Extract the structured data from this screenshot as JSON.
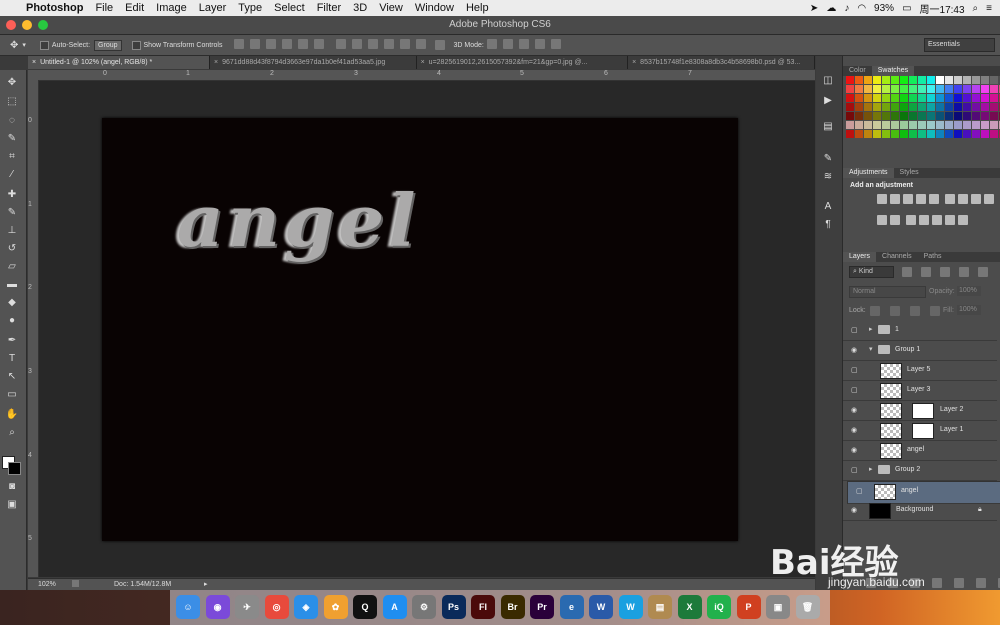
{
  "menubar": {
    "app": "Photoshop",
    "items": [
      "File",
      "Edit",
      "Image",
      "Layer",
      "Type",
      "Select",
      "Filter",
      "3D",
      "View",
      "Window",
      "Help"
    ],
    "battery": "93%",
    "clock": "周一17:43"
  },
  "window": {
    "title": "Adobe Photoshop CS6"
  },
  "options": {
    "auto_select_label": "Auto-Select:",
    "auto_select_value": "Group",
    "show_transform_label": "Show Transform Controls",
    "mode3d_label": "3D Mode:",
    "workspace": "Essentials"
  },
  "tabs": [
    {
      "label": "Untitled-1 @ 102% (angel, RGB/8) *"
    },
    {
      "label": "9671dd88d43f8794d3663e97da1b0ef41ad53aa5.jpg"
    },
    {
      "label": "u=2825619012,2615057392&fm=21&gp=0.jpg @..."
    },
    {
      "label": "8537b15748f1e8308a8db3c4b58698b0.psd @ 53..."
    }
  ],
  "ruler_h": [
    "0",
    "1",
    "2",
    "3",
    "4",
    "5",
    "6",
    "7"
  ],
  "ruler_v": [
    "0",
    "1",
    "2",
    "3",
    "4",
    "5"
  ],
  "canvas": {
    "text": "angel"
  },
  "status": {
    "zoom": "102%",
    "doc": "Doc: 1.54M/12.8M"
  },
  "panels": {
    "color_tabs": [
      "Color",
      "Swatches"
    ],
    "adjust_tabs": [
      "Adjustments",
      "Styles"
    ],
    "add_adjustment": "Add an adjustment",
    "layer_tabs": [
      "Layers",
      "Channels",
      "Paths"
    ],
    "kind": "Kind",
    "blend": "Normal",
    "opacity_label": "Opacity:",
    "opacity": "100%",
    "lock_label": "Lock:",
    "fill_label": "Fill:",
    "fill": "100%"
  },
  "layers": [
    {
      "name": "1",
      "type": "group",
      "visible": false
    },
    {
      "name": "Group 1",
      "type": "group-open",
      "visible": true
    },
    {
      "name": "Layer 5",
      "type": "layer",
      "visible": false
    },
    {
      "name": "Layer 3",
      "type": "layer",
      "visible": false
    },
    {
      "name": "Layer 2",
      "type": "masked",
      "visible": true
    },
    {
      "name": "Layer 1",
      "type": "masked",
      "visible": true
    },
    {
      "name": "angel",
      "type": "layer",
      "visible": true
    },
    {
      "name": "Group 2",
      "type": "group",
      "visible": false
    },
    {
      "name": "angel",
      "type": "selected",
      "visible": false
    },
    {
      "name": "Background",
      "type": "background",
      "visible": true
    }
  ],
  "watermark": {
    "brand": "Bai经验",
    "url": "jingyan.baidu.com"
  },
  "dock_apps": [
    "Finder",
    "Siri",
    "Launchpad",
    "Chrome",
    "Safari",
    "Photos",
    "QQ",
    "App Store",
    "System Preferences",
    "Ps",
    "Fl",
    "Br",
    "Pr",
    "Edge",
    "Word",
    "WPS",
    "Archive",
    "Excel",
    "iQIYI",
    "PowerPoint",
    "Preview",
    "Trash"
  ]
}
